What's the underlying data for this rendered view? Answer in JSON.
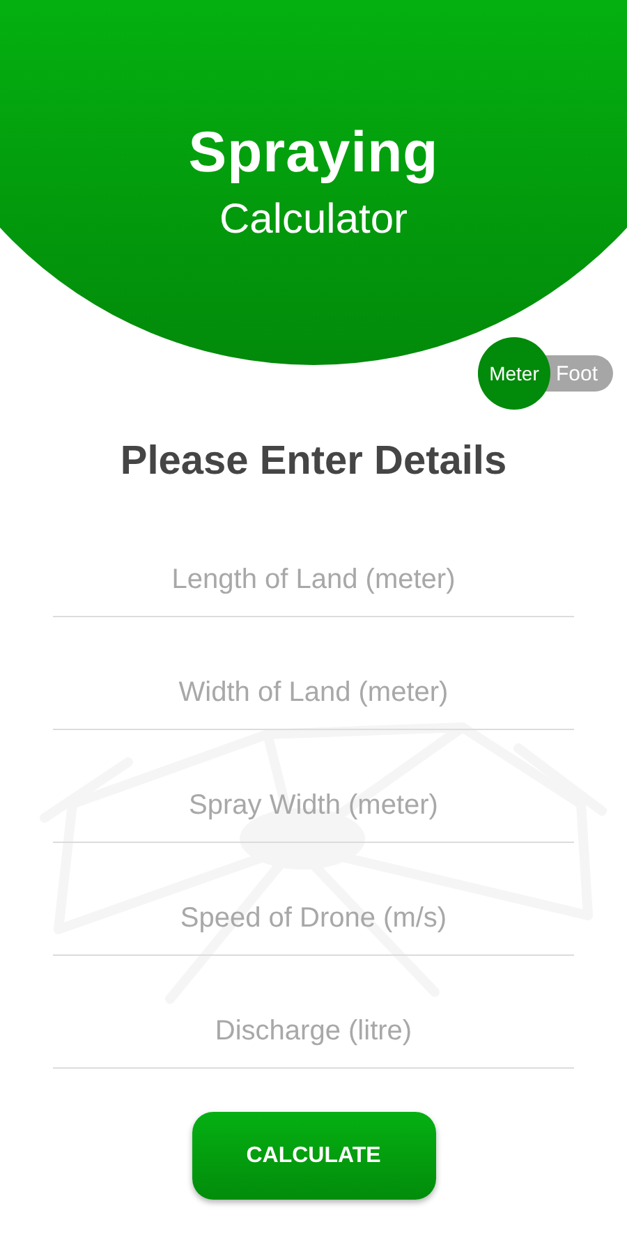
{
  "header": {
    "title": "Spraying",
    "subtitle": "Calculator"
  },
  "unit_toggle": [
    {
      "label": "Meter",
      "selected": true
    },
    {
      "label": "Foot",
      "selected": false
    }
  ],
  "form": {
    "title": "Please Enter Details",
    "fields": [
      {
        "placeholder": "Length of Land (meter)"
      },
      {
        "placeholder": "Width of Land (meter)"
      },
      {
        "placeholder": "Spray Width (meter)"
      },
      {
        "placeholder": "Speed of Drone (m/s)"
      },
      {
        "placeholder": "Discharge (litre)"
      }
    ]
  },
  "calculate_button": {
    "label": "CALCULATE"
  }
}
